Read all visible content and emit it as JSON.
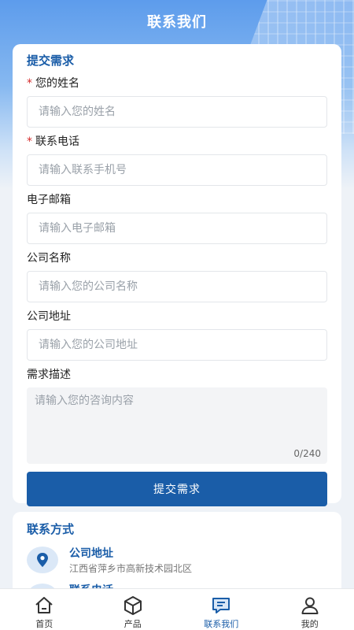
{
  "header": {
    "title": "联系我们"
  },
  "form": {
    "title": "提交需求",
    "fields": [
      {
        "label": "您的姓名",
        "required": true,
        "placeholder": "请输入您的姓名"
      },
      {
        "label": "联系电话",
        "required": true,
        "placeholder": "请输入联系手机号"
      },
      {
        "label": "电子邮箱",
        "required": false,
        "placeholder": "请输入电子邮箱"
      },
      {
        "label": "公司名称",
        "required": false,
        "placeholder": "请输入您的公司名称"
      },
      {
        "label": "公司地址",
        "required": false,
        "placeholder": "请输入您的公司地址"
      }
    ],
    "description": {
      "label": "需求描述",
      "placeholder": "请输入您的咨询内容",
      "counter": "0/240"
    },
    "required_mark": "*",
    "submit_label": "提交需求"
  },
  "contact": {
    "title": "联系方式",
    "items": [
      {
        "name": "公司地址",
        "value": "江西省萍乡市高新技术园北区",
        "icon": "location-pin-icon"
      },
      {
        "name": "联系电话",
        "value": "",
        "icon": "phone-icon"
      }
    ]
  },
  "tabbar": {
    "items": [
      {
        "label": "首页",
        "icon": "home-icon",
        "active": false
      },
      {
        "label": "产品",
        "icon": "cube-icon",
        "active": false
      },
      {
        "label": "联系我们",
        "icon": "message-icon",
        "active": true
      },
      {
        "label": "我的",
        "icon": "user-icon",
        "active": false
      }
    ]
  },
  "colors": {
    "accent": "#1a5da8",
    "required": "#d62c2c",
    "header_top": "#5d9cec"
  }
}
